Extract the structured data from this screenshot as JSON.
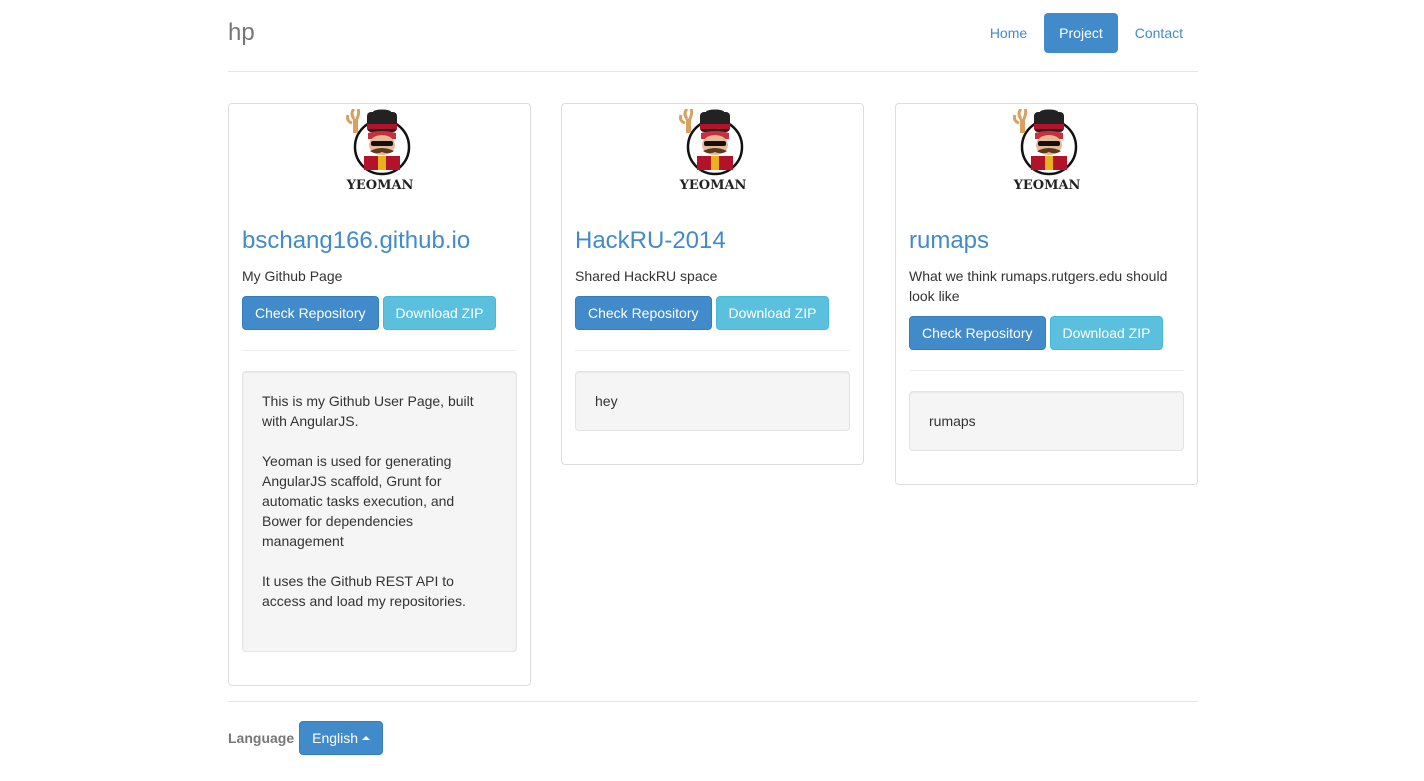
{
  "header": {
    "brand": "hp",
    "nav": [
      {
        "label": "Home",
        "active": false
      },
      {
        "label": "Project",
        "active": true
      },
      {
        "label": "Contact",
        "active": false
      }
    ]
  },
  "projects": [
    {
      "logo_text": "YEOMAN",
      "title": "bschang166.github.io",
      "description": "My Github Page",
      "check_label": "Check Repository",
      "download_label": "Download ZIP",
      "readme": [
        "This is my Github User Page, built with AngularJS.",
        "Yeoman is used for generating AngularJS scaffold, Grunt for automatic tasks execution, and Bower for dependencies management",
        "It uses the Github REST API to access and load my repositories."
      ]
    },
    {
      "logo_text": "YEOMAN",
      "title": "HackRU-2014",
      "description": "Shared HackRU space",
      "check_label": "Check Repository",
      "download_label": "Download ZIP",
      "readme": [
        "hey"
      ]
    },
    {
      "logo_text": "YEOMAN",
      "title": "rumaps",
      "description": "What we think rumaps.rutgers.edu should look like",
      "check_label": "Check Repository",
      "download_label": "Download ZIP",
      "readme": [
        "rumaps"
      ]
    }
  ],
  "footer": {
    "language_label": "Language",
    "language_value": "English"
  },
  "colors": {
    "primary": "#428bca",
    "info": "#5bc0de",
    "well_bg": "#f5f5f5"
  }
}
